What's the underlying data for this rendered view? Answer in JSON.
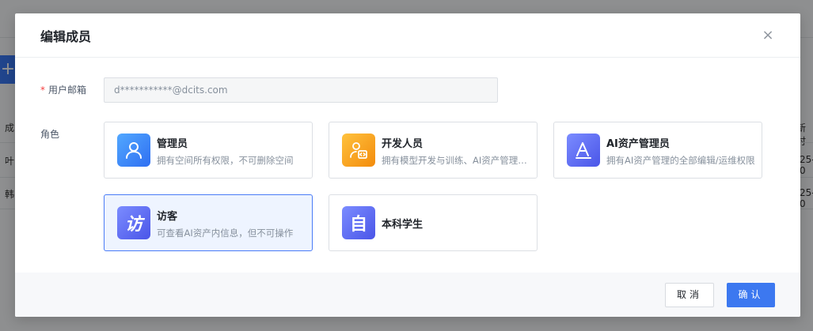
{
  "background": {
    "plus_glyph": "+",
    "col_header_left": "成",
    "col_header_right": "新时",
    "row1_left": "叶",
    "row1_right": "25-0",
    "row2_left": "韩",
    "row2_right": "25-0"
  },
  "modal": {
    "title": "编辑成员",
    "close_glyph": "×",
    "email_label": "用户邮箱",
    "required_mark": "*",
    "email_value": "d***********@dcits.com",
    "role_label": "角色",
    "roles": [
      {
        "name": "管理员",
        "desc": "拥有空间所有权限，不可删除空间",
        "icon": "user-icon",
        "color": "#3d8bfd"
      },
      {
        "name": "开发人员",
        "desc": "拥有模型开发与训练、AI资产管理等权限",
        "icon": "developer-icon",
        "color": "#f7a21b"
      },
      {
        "name": "AI资产管理员",
        "desc": "拥有AI资产管理的全部编辑/运维权限",
        "icon": "ai-letter-icon",
        "color": "#5b6cf0"
      },
      {
        "name": "访客",
        "desc": "可查看AI资产内信息，但不可操作",
        "icon": "visitor-char-icon",
        "glyph": "访",
        "color": "#5b6cf0",
        "selected": true
      },
      {
        "name": "本科学生",
        "desc": "",
        "icon": "self-char-icon",
        "glyph": "自",
        "color": "#5b6cf0"
      }
    ],
    "cancel_label": "取消",
    "ok_label": "确认"
  }
}
